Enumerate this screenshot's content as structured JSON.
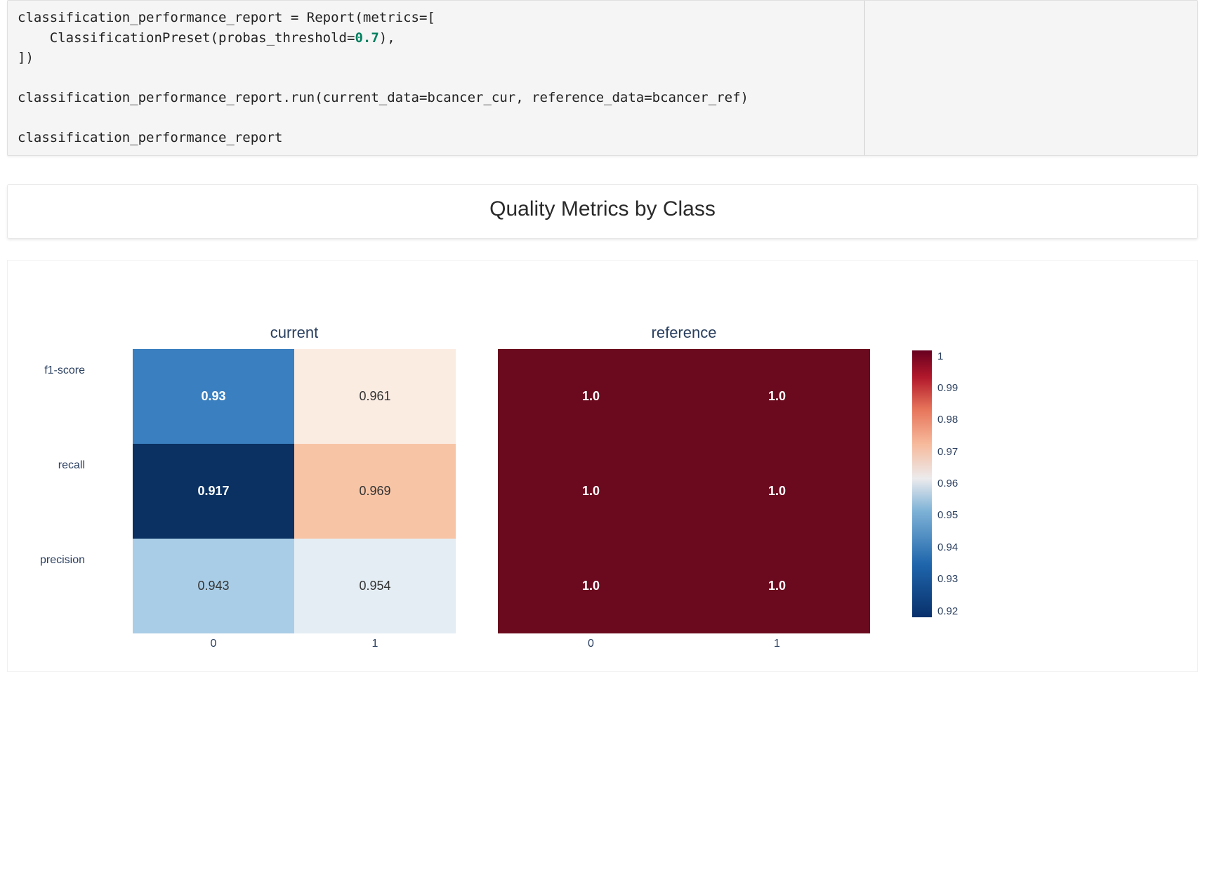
{
  "code": {
    "line1a": "classification_performance_report = Report(metrics=[",
    "line2a": "    ClassificationPreset(probas_threshold=",
    "line2b": "0.7",
    "line2c": "),",
    "line3": "])",
    "line4": "",
    "line5": "classification_performance_report.run(current_data=bcancer_cur, reference_data=bcancer_ref)",
    "line6": "",
    "line7": "classification_performance_report"
  },
  "section": {
    "title": "Quality Metrics by Class"
  },
  "chart_data": {
    "type": "heatmap",
    "subplots": [
      "current",
      "reference"
    ],
    "y_categories": [
      "f1-score",
      "recall",
      "precision"
    ],
    "x_categories": [
      "0",
      "1"
    ],
    "series": [
      {
        "name": "current",
        "z": [
          [
            0.93,
            0.961
          ],
          [
            0.917,
            0.969
          ],
          [
            0.943,
            0.954
          ]
        ],
        "text": [
          [
            "0.93",
            "0.961"
          ],
          [
            "0.917",
            "0.969"
          ],
          [
            "0.943",
            "0.954"
          ]
        ]
      },
      {
        "name": "reference",
        "z": [
          [
            1.0,
            1.0
          ],
          [
            1.0,
            1.0
          ],
          [
            1.0,
            1.0
          ]
        ],
        "text": [
          [
            "1.0",
            "1.0"
          ],
          [
            "1.0",
            "1.0"
          ],
          [
            "1.0",
            "1.0"
          ]
        ]
      }
    ],
    "colorscale": "RdBu_r",
    "zmin": 0.917,
    "zmax": 1.0,
    "colorbar_ticks": [
      "1",
      "0.99",
      "0.98",
      "0.97",
      "0.96",
      "0.95",
      "0.94",
      "0.93",
      "0.92"
    ]
  },
  "cell_colors": {
    "current": [
      [
        "#3a7fbf",
        "#fbece2"
      ],
      [
        "#0a3161",
        "#f7c5a6"
      ],
      [
        "#a9cde6",
        "#e4edf3"
      ]
    ],
    "reference": [
      [
        "#6b0a1e",
        "#6b0a1e"
      ],
      [
        "#6b0a1e",
        "#6b0a1e"
      ],
      [
        "#6b0a1e",
        "#6b0a1e"
      ]
    ]
  },
  "text_colors": {
    "current": [
      [
        "#ffffff",
        "#333333"
      ],
      [
        "#ffffff",
        "#333333"
      ],
      [
        "#333333",
        "#333333"
      ]
    ],
    "reference": [
      [
        "#ffffff",
        "#ffffff"
      ],
      [
        "#ffffff",
        "#ffffff"
      ],
      [
        "#ffffff",
        "#ffffff"
      ]
    ]
  }
}
